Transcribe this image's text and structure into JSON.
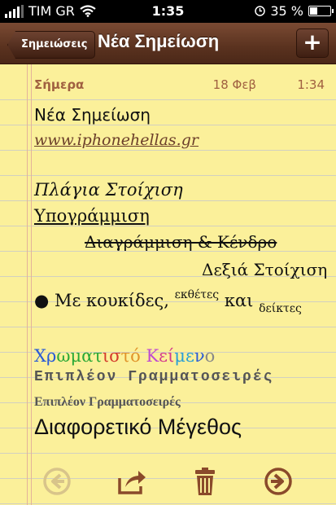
{
  "status": {
    "carrier": "TIM GR",
    "time": "1:35",
    "battery_percent": "35 %",
    "battery_level": 0.35
  },
  "navbar": {
    "back_label": "Σημειώσεις",
    "title": "Νέα Σημείωση",
    "add_label": "+"
  },
  "note": {
    "day_label": "Σήμερα",
    "date": "18 Φεβ",
    "time": "1:34",
    "title_line": "Νέα Σημείωση",
    "link": "www.iphonehellas.gr",
    "italic_line": "Πλάγια Στοίχιση",
    "underline_line": "Υπογράμμιση",
    "strike_line": "Διαγράμμιση & Κένδρο",
    "right_line": "Δεξιά Στοίχιση",
    "bullet_main": "Με κουκίδες,",
    "bullet_sup": "εκθέτες",
    "bullet_mid": "και",
    "bullet_sub": "δείκτες",
    "colored_text": [
      {
        "ch": "Χ",
        "color": "#2a5bd6"
      },
      {
        "ch": "ρ",
        "color": "#2a5bd6"
      },
      {
        "ch": "ω",
        "color": "#2aa836"
      },
      {
        "ch": "μ",
        "color": "#2aa836"
      },
      {
        "ch": "α",
        "color": "#2aa836"
      },
      {
        "ch": "τ",
        "color": "#2aa836"
      },
      {
        "ch": "ι",
        "color": "#d43a2c"
      },
      {
        "ch": "σ",
        "color": "#d43a2c"
      },
      {
        "ch": "τ",
        "color": "#e0932a"
      },
      {
        "ch": "ό",
        "color": "#e0932a"
      },
      {
        "ch": " ",
        "color": "#000000"
      },
      {
        "ch": "Κ",
        "color": "#c04bd0"
      },
      {
        "ch": "ε",
        "color": "#d43a8c"
      },
      {
        "ch": "ί",
        "color": "#d43a8c"
      },
      {
        "ch": "μ",
        "color": "#2a9ed6"
      },
      {
        "ch": "ε",
        "color": "#2a9ed6"
      },
      {
        "ch": "ν",
        "color": "#2a5bd6"
      },
      {
        "ch": "ο",
        "color": "#888888"
      }
    ],
    "font_line_1": "Επιπλέον Γραμματοσειρές",
    "font_line_2": "Επιπλέον Γραμματοσειρές",
    "size_line": "Διαφορετικό Μέγεθος"
  },
  "toolbar": {
    "icons": [
      "arrow-left-icon",
      "share-icon",
      "trash-icon",
      "arrow-right-icon"
    ],
    "accent": "#8a4a2a",
    "disabled": "#d8c48a"
  }
}
